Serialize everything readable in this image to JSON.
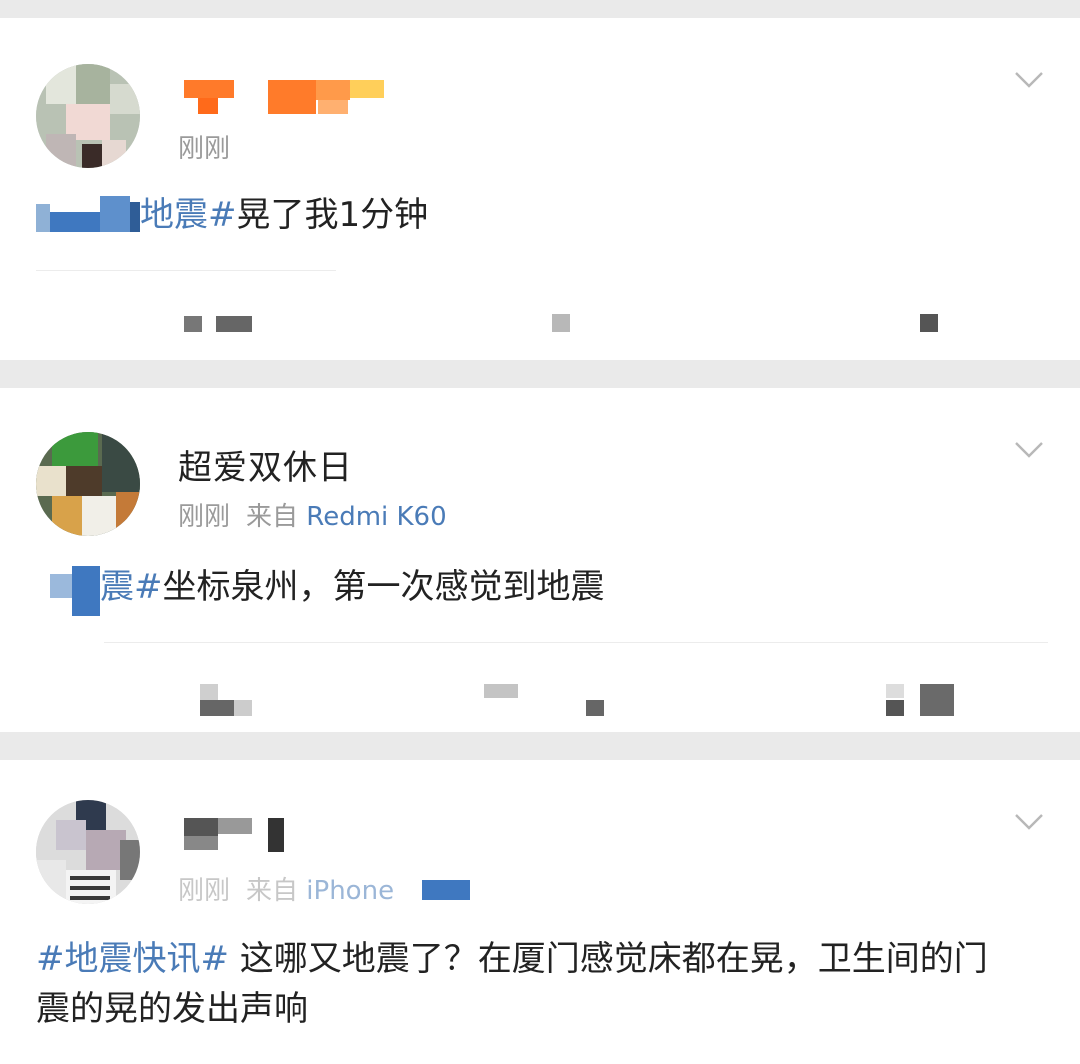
{
  "posts": [
    {
      "username": "",
      "time": "刚刚",
      "source_prefix": "",
      "source": "",
      "hashtag_end": "地震#",
      "body": "晃了我1分钟",
      "more_icon": "chevron-down-icon"
    },
    {
      "username": "超爱双休日",
      "time": "刚刚",
      "source_prefix": "来自",
      "source": "Redmi K60",
      "hashtag_end": "震#",
      "body": "坐标泉州，第一次感觉到地震",
      "more_icon": "chevron-down-icon"
    },
    {
      "username": "",
      "time": "刚刚",
      "source_prefix": "来自",
      "source": "iPhone",
      "hashtag": "#地震快讯#",
      "body": " 这哪又地震了？在厦门感觉床都在晃，卫生间的门震的晃的发出声响",
      "more_icon": "chevron-down-icon"
    }
  ],
  "colors": {
    "link": "#4a7bb7",
    "meta": "#9a9a9a",
    "text": "#222222",
    "background": "#eaeaea",
    "card": "#ffffff"
  }
}
